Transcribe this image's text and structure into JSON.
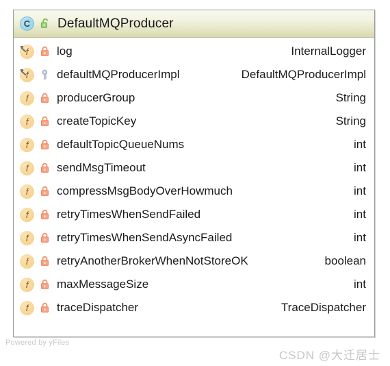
{
  "class_node": {
    "header": {
      "type_icon": "class-icon",
      "type_icon_letter": "C",
      "visibility_icon": "unlock-icon",
      "visibility": "public",
      "name": "DefaultMQProducer"
    },
    "attributes": [
      {
        "member_icon": "field-icon",
        "member_icon_letter": "f",
        "static": true,
        "visibility_icon": "lock-icon",
        "visibility": "private",
        "name": "log",
        "type": "InternalLogger"
      },
      {
        "member_icon": "field-icon",
        "member_icon_letter": "f",
        "static": true,
        "visibility_icon": "key-icon",
        "visibility": "protected",
        "name": "defaultMQProducerImpl",
        "type": "DefaultMQProducerImpl"
      },
      {
        "member_icon": "field-icon",
        "member_icon_letter": "f",
        "static": false,
        "visibility_icon": "lock-icon",
        "visibility": "private",
        "name": "producerGroup",
        "type": "String"
      },
      {
        "member_icon": "field-icon",
        "member_icon_letter": "f",
        "static": false,
        "visibility_icon": "lock-icon",
        "visibility": "private",
        "name": "createTopicKey",
        "type": "String"
      },
      {
        "member_icon": "field-icon",
        "member_icon_letter": "f",
        "static": false,
        "visibility_icon": "lock-icon",
        "visibility": "private",
        "name": "defaultTopicQueueNums",
        "type": "int"
      },
      {
        "member_icon": "field-icon",
        "member_icon_letter": "f",
        "static": false,
        "visibility_icon": "lock-icon",
        "visibility": "private",
        "name": "sendMsgTimeout",
        "type": "int"
      },
      {
        "member_icon": "field-icon",
        "member_icon_letter": "f",
        "static": false,
        "visibility_icon": "lock-icon",
        "visibility": "private",
        "name": "compressMsgBodyOverHowmuch",
        "type": "int"
      },
      {
        "member_icon": "field-icon",
        "member_icon_letter": "f",
        "static": false,
        "visibility_icon": "lock-icon",
        "visibility": "private",
        "name": "retryTimesWhenSendFailed",
        "type": "int"
      },
      {
        "member_icon": "field-icon",
        "member_icon_letter": "f",
        "static": false,
        "visibility_icon": "lock-icon",
        "visibility": "private",
        "name": "retryTimesWhenSendAsyncFailed",
        "type": "int"
      },
      {
        "member_icon": "field-icon",
        "member_icon_letter": "f",
        "static": false,
        "visibility_icon": "lock-icon",
        "visibility": "private",
        "name": "retryAnotherBrokerWhenNotStoreOK",
        "type": "boolean"
      },
      {
        "member_icon": "field-icon",
        "member_icon_letter": "f",
        "static": false,
        "visibility_icon": "lock-icon",
        "visibility": "private",
        "name": "maxMessageSize",
        "type": "int"
      },
      {
        "member_icon": "field-icon",
        "member_icon_letter": "f",
        "static": false,
        "visibility_icon": "lock-icon",
        "visibility": "private",
        "name": "traceDispatcher",
        "type": "TraceDispatcher"
      }
    ]
  },
  "watermarks": {
    "yfiles": "Powered by yFiles",
    "csdn": "CSDN @大迁居士"
  },
  "colors": {
    "header_top": "#f7f8ec",
    "header_bottom": "#d8d9b0",
    "node_border": "#9a9a9a",
    "class_icon": "#a5d8ec",
    "field_icon": "#f9d79a",
    "lock_private": "#f2916d",
    "key_protected": "#b9c3cc",
    "unlock_public": "#7ebf5a",
    "text": "#1a1a1a",
    "watermark": "#c7c7c7"
  }
}
